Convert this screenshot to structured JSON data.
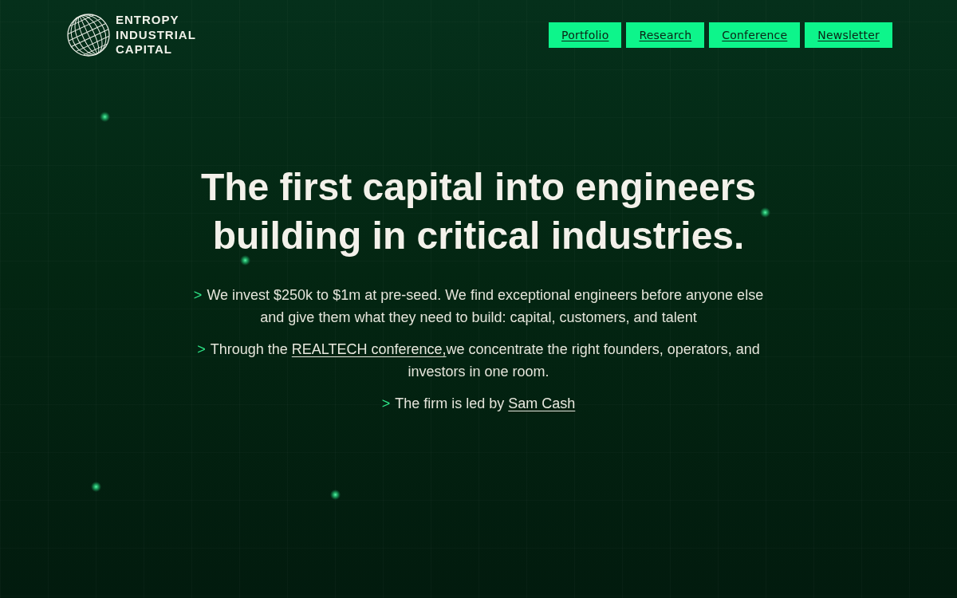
{
  "logo": {
    "lines": [
      "ENTROPY",
      "INDUSTRIAL",
      "CAPITAL"
    ]
  },
  "nav": [
    {
      "label": "Portfolio"
    },
    {
      "label": "Research"
    },
    {
      "label": "Conference"
    },
    {
      "label": "Newsletter"
    }
  ],
  "hero": {
    "heading": "The first capital into engineers building in critical industries.",
    "points": [
      {
        "marker": ">",
        "segments": [
          {
            "kind": "text",
            "text": "We invest $250k to $1m at pre-seed. We find exceptional engineers before anyone else and give them what they need to build: capital, customers, and talent"
          }
        ]
      },
      {
        "marker": ">",
        "segments": [
          {
            "kind": "text",
            "text": "Through the "
          },
          {
            "kind": "link",
            "text": "REALTECH conference,"
          },
          {
            "kind": "text",
            "text": "we concentrate the right founders, operators, and investors in one room."
          }
        ]
      },
      {
        "marker": ">",
        "segments": [
          {
            "kind": "text",
            "text": "The firm is led by "
          },
          {
            "kind": "link",
            "text": "Sam Cash"
          }
        ]
      }
    ]
  }
}
